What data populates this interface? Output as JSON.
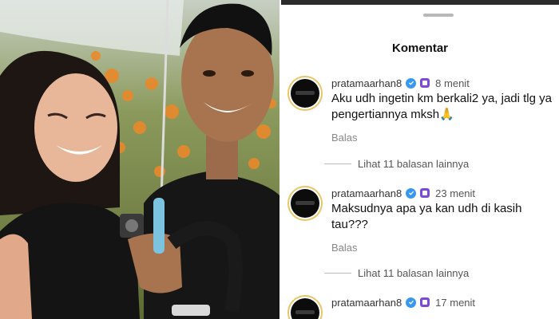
{
  "panel": {
    "title": "Komentar",
    "comments": [
      {
        "username": "pratamaarhan8",
        "time": "8 menit",
        "text": "Aku udh ingetin km berkali2 ya, jadi tlg ya pengertiannya mksh🙏",
        "reply_label": "Balas",
        "more_replies": "Lihat 11 balasan lainnya"
      },
      {
        "username": "pratamaarhan8",
        "time": "23 menit",
        "text": "Maksudnya apa ya kan udh di kasih tau???",
        "reply_label": "Balas",
        "more_replies": "Lihat 11 balasan lainnya"
      },
      {
        "username": "pratamaarhan8",
        "time": "17 menit",
        "text": ""
      }
    ]
  },
  "colors": {
    "verified": "#3897f0",
    "badge": "#7b4bd8",
    "avatar_ring": "#e9c56a"
  }
}
